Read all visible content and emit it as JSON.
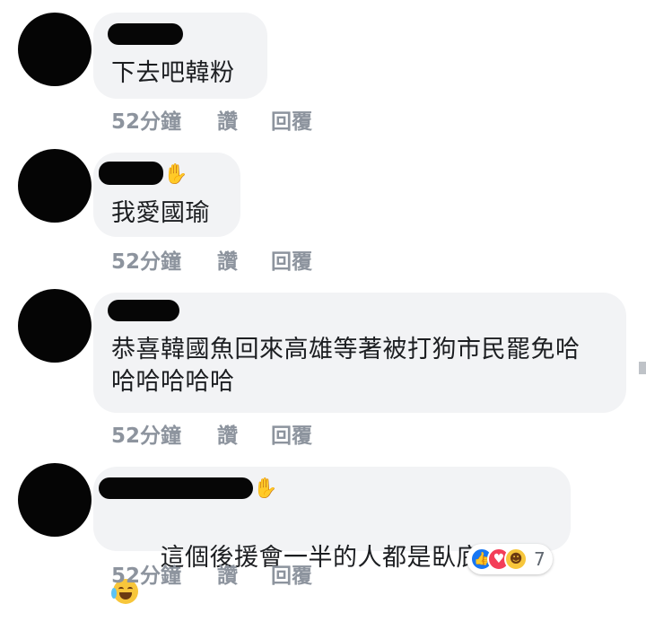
{
  "comments": [
    {
      "text": "下去吧韓粉",
      "time": "52分鐘",
      "like": "讚",
      "reply": "回覆"
    },
    {
      "text": "我愛國瑜",
      "time": "52分鐘",
      "like": "讚",
      "reply": "回覆"
    },
    {
      "text": "恭喜韓國魚回來高雄等著被打狗市民罷免哈\n哈哈哈哈哈",
      "time": "52分鐘",
      "like": "讚",
      "reply": "回覆"
    },
    {
      "text": "這個後援會一半的人都是臥底吧",
      "time": "52分鐘",
      "like": "讚",
      "reply": "回覆",
      "reactions_count": "7"
    }
  ],
  "icons": {
    "wave": "waving-hand-icon",
    "like_reaction": "thumbs-up-icon",
    "love_reaction": "heart-icon",
    "haha_reaction": "laughing-emoji-icon",
    "tears_emoji": "tears-of-joy-emoji-icon"
  },
  "colors": {
    "bubble": "#f2f3f5",
    "meta_text": "#8d949e",
    "like_blue": "#1877f2",
    "love_red": "#f33e58",
    "haha_yellow": "#f7c63b"
  }
}
